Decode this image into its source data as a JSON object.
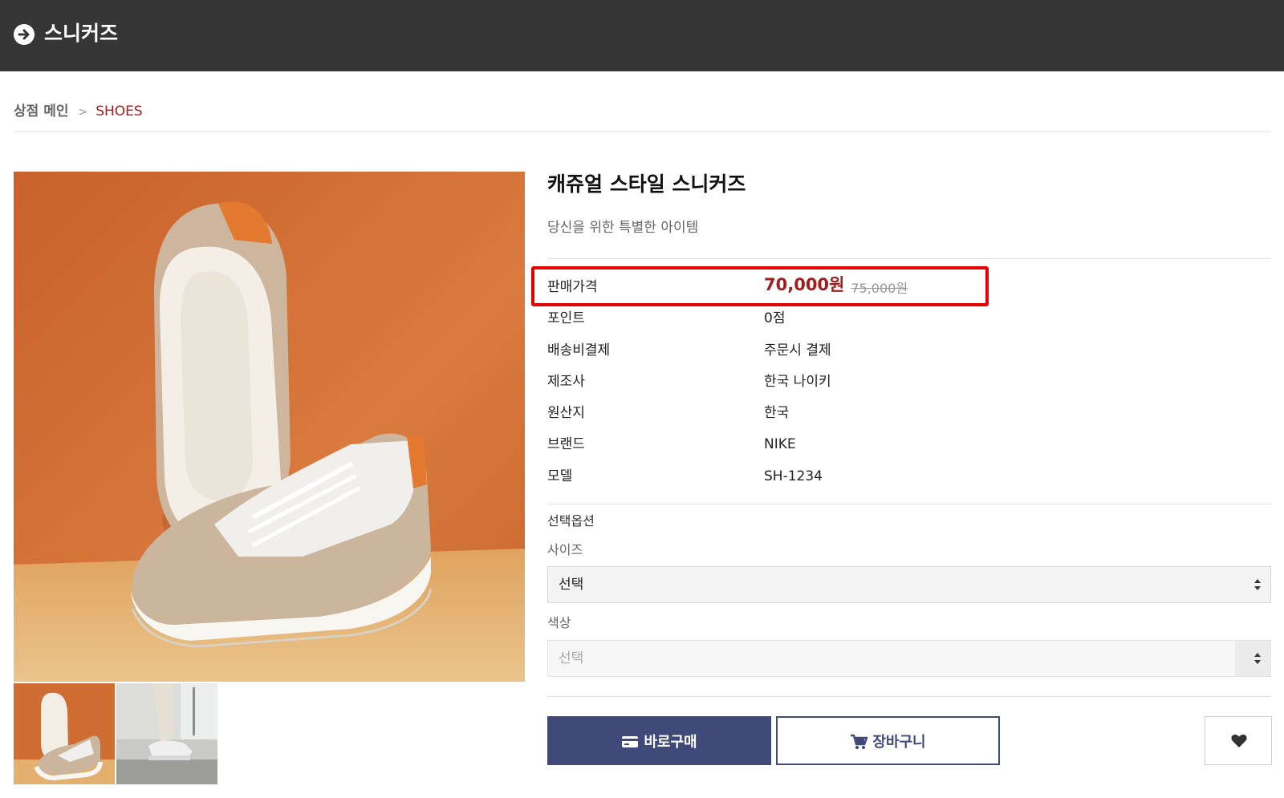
{
  "header": {
    "title": "스니커즈",
    "nav_icon": "arrow-right-circle-icon"
  },
  "breadcrumb": {
    "home": "상점 메인",
    "separator": ">",
    "current": "SHOES"
  },
  "product": {
    "name": "캐쥬얼 스타일 스니커즈",
    "summary": "당신을 위한 특별한 아이템",
    "price": {
      "label": "판매가격",
      "sale": "70,000원",
      "original": "75,000원"
    },
    "info": [
      {
        "key": "포인트",
        "value": "0점"
      },
      {
        "key": "배송비결제",
        "value": "주문시 결제"
      },
      {
        "key": "제조사",
        "value": "한국 나이키"
      },
      {
        "key": "원산지",
        "value": "한국"
      },
      {
        "key": "브랜드",
        "value": "NIKE"
      },
      {
        "key": "모델",
        "value": "SH-1234"
      }
    ]
  },
  "options": {
    "title": "선택옵션",
    "size": {
      "label": "사이즈",
      "selected": "선택"
    },
    "color": {
      "label": "색상",
      "selected": "선택"
    }
  },
  "actions": {
    "buy": "바로구매",
    "cart": "장바구니",
    "wish_icon": "heart-icon",
    "buy_icon": "credit-card-icon",
    "cart_icon": "cart-icon"
  },
  "colors": {
    "header_bg": "#363636",
    "accent_red": "#a21d1d",
    "highlight": "#e60000",
    "button_navy": "#3f4a79"
  }
}
